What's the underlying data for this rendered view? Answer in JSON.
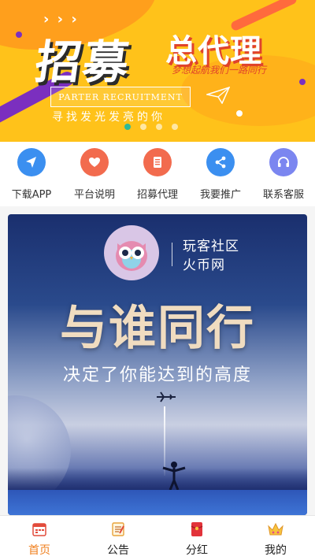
{
  "banner": {
    "big_title": "招募",
    "title2": "总代理",
    "slogan": "梦想起航我们一路同行",
    "subtitle": "PARTER RECRUITMENT",
    "tagline": "寻找发光发亮的你",
    "decor": "› › ›",
    "pager_count": 4,
    "pager_active": 1
  },
  "quick_nav": [
    {
      "label": "下载APP",
      "icon": "navigate-arrow-icon",
      "color": "#3b8ff0"
    },
    {
      "label": "平台说明",
      "icon": "heart-icon",
      "color": "#f26b4e"
    },
    {
      "label": "招募代理",
      "icon": "document-icon",
      "color": "#f26b4e"
    },
    {
      "label": "我要推广",
      "icon": "share-icon",
      "color": "#3b8ff0"
    },
    {
      "label": "联系客服",
      "icon": "headset-icon",
      "color": "#7b86f0"
    }
  ],
  "poster": {
    "brand_line1": "玩客社区",
    "brand_line2": "火币网",
    "headline": "与谁同行",
    "subhead": "决定了你能达到的高度"
  },
  "tabbar": [
    {
      "label": "首页",
      "icon": "calendar-icon",
      "active": true
    },
    {
      "label": "公告",
      "icon": "notepad-icon",
      "active": false
    },
    {
      "label": "分红",
      "icon": "red-envelope-icon",
      "active": false
    },
    {
      "label": "我的",
      "icon": "crown-icon",
      "active": false
    }
  ],
  "colors": {
    "banner_bg": "#ffc21a",
    "accent_active_tab": "#f0801f",
    "blue_icon": "#3b8ff0",
    "orange_icon": "#f26b4e",
    "purple_icon": "#7b86f0"
  }
}
